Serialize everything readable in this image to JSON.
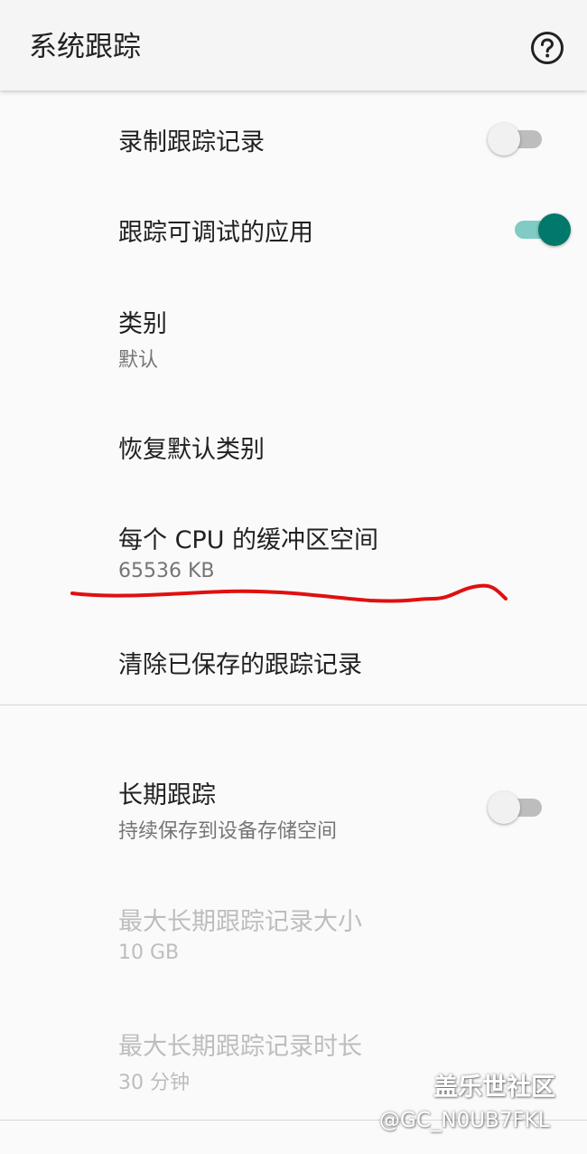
{
  "app_bar": {
    "title": "系统跟踪",
    "help_icon": "help-circle-icon"
  },
  "preferences": [
    {
      "title": "录制跟踪记录",
      "switch": "off"
    },
    {
      "title": "跟踪可调试的应用",
      "switch": "on"
    },
    {
      "title": "类别",
      "summary": "默认"
    },
    {
      "title": "恢复默认类别"
    },
    {
      "title": "每个 CPU 的缓冲区空间",
      "summary": "65536 KB"
    },
    {
      "title": "清除已保存的跟踪记录"
    }
  ],
  "long_term": [
    {
      "title": "长期跟踪",
      "summary": "持续保存到设备存储空间",
      "switch": "off"
    },
    {
      "title": "最大长期跟踪记录大小",
      "summary": "10 GB",
      "enabled": false
    },
    {
      "title": "最大长期跟踪记录时长",
      "summary": "30 分钟",
      "enabled": false
    }
  ],
  "colors": {
    "accent": "#00796b",
    "accent_track": "#80cbc4",
    "annotation": "#e01010"
  },
  "watermark": {
    "brand": "盖乐世社区",
    "user": "@GC_N0UB7FKL"
  }
}
